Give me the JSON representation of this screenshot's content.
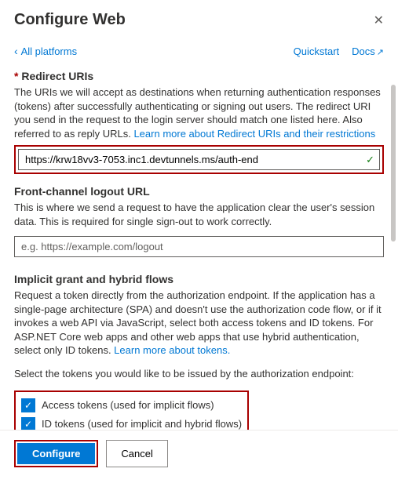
{
  "header": {
    "title": "Configure Web"
  },
  "topbar": {
    "back": "All platforms",
    "quickstart": "Quickstart",
    "docs": "Docs"
  },
  "redirect": {
    "title": "Redirect URIs",
    "desc": "The URIs we will accept as destinations when returning authentication responses (tokens) after successfully authenticating or signing out users. The redirect URI you send in the request to the login server should match one listed here. Also referred to as reply URLs. ",
    "learn": "Learn more about Redirect URIs and their restrictions",
    "value": "https://krw18vv3-7053.inc1.devtunnels.ms/auth-end"
  },
  "logout": {
    "title": "Front-channel logout URL",
    "desc": "This is where we send a request to have the application clear the user's session data. This is required for single sign-out to work correctly.",
    "placeholder": "e.g. https://example.com/logout"
  },
  "implicit": {
    "title": "Implicit grant and hybrid flows",
    "desc": "Request a token directly from the authorization endpoint. If the application has a single-page architecture (SPA) and doesn't use the authorization code flow, or if it invokes a web API via JavaScript, select both access tokens and ID tokens. For ASP.NET Core web apps and other web apps that use hybrid authentication, select only ID tokens. ",
    "learn": "Learn more about tokens.",
    "select_label": "Select the tokens you would like to be issued by the authorization endpoint:",
    "access_tokens": "Access tokens (used for implicit flows)",
    "id_tokens": "ID tokens (used for implicit and hybrid flows)"
  },
  "footer": {
    "configure": "Configure",
    "cancel": "Cancel"
  }
}
